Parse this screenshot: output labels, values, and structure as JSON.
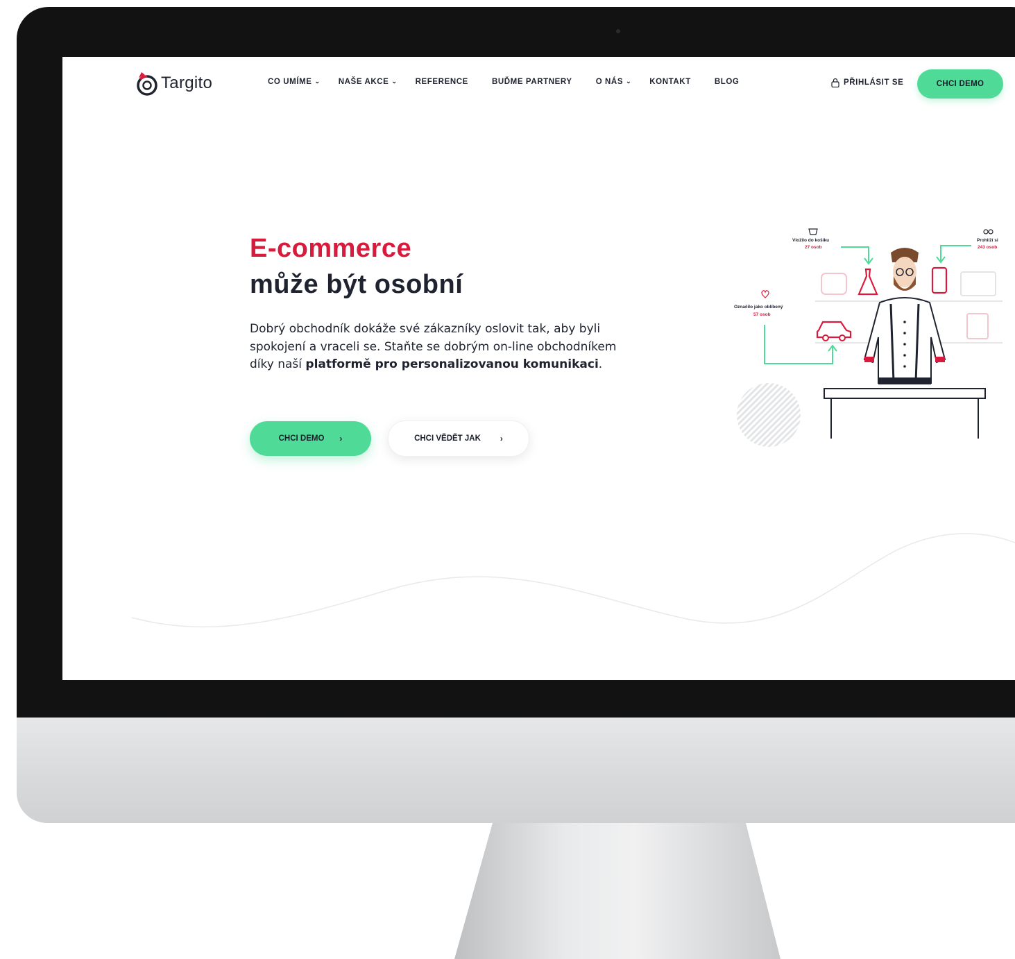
{
  "brand": {
    "name": "Targito",
    "accent": "#d81b3c",
    "cta_color": "#4fdb97",
    "text_color": "#1f2330"
  },
  "nav": {
    "items": [
      {
        "label": "CO UMÍME",
        "has_dropdown": true
      },
      {
        "label": "NAŠE AKCE",
        "has_dropdown": true
      },
      {
        "label": "REFERENCE",
        "has_dropdown": false
      },
      {
        "label": "BUĎME PARTNERY",
        "has_dropdown": false
      },
      {
        "label": "O NÁS",
        "has_dropdown": true
      },
      {
        "label": "KONTAKT",
        "has_dropdown": false
      },
      {
        "label": "BLOG",
        "has_dropdown": false
      }
    ],
    "login_label": "PŘIHLÁSIT SE",
    "login_icon": "lock-icon",
    "demo_label": "CHCI DEMO"
  },
  "hero": {
    "title_accent": "E-commerce",
    "title_main": "může být osobní",
    "lead_plain_1": "Dobrý obchodník dokáže své zákazníky oslovit tak, aby byli spokojení a vraceli se. Staňte se dobrým on-line obchodníkem díky naší ",
    "lead_bold": "platformě pro personalizovanou komunikaci",
    "lead_plain_2": ".",
    "cta_primary": "CHCI DEMO",
    "cta_secondary": "CHCI VĚDĚT JAK",
    "arrow": "›"
  },
  "illustration": {
    "cart": {
      "label": "Vložilo do košíku",
      "count": "27 osob",
      "icon": "cart-icon"
    },
    "view": {
      "label": "Prohlíží si",
      "count": "243 osob",
      "icon": "binoculars-icon"
    },
    "fav": {
      "label": "Označilo jako oblíbený",
      "count": "57 osob",
      "icon": "heart-icon"
    }
  }
}
